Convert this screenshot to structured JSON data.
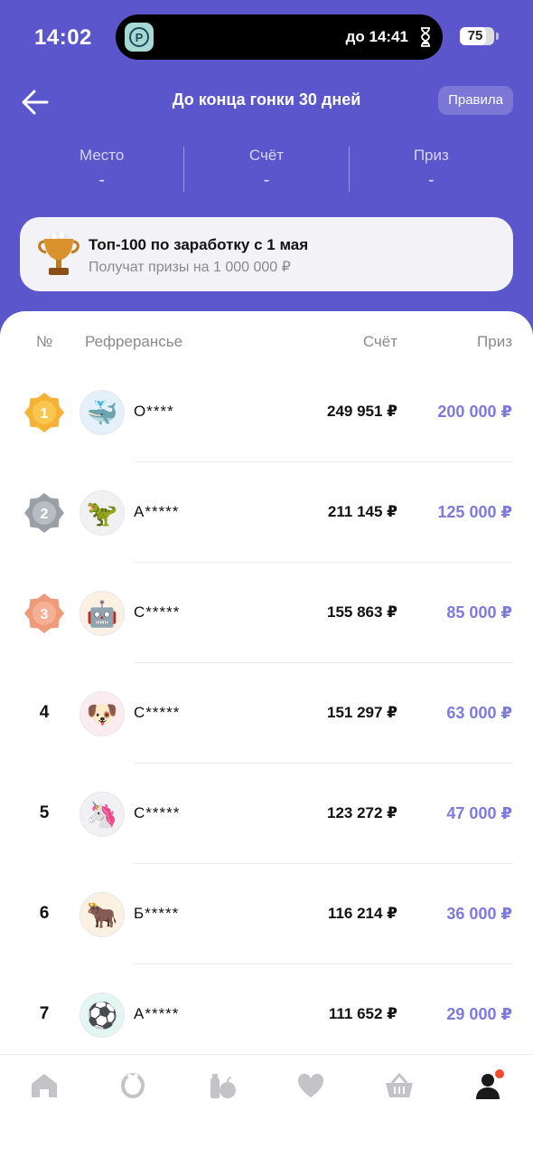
{
  "status_bar": {
    "time": "14:02",
    "activity_icon": "P",
    "activity_text": "до 14:41",
    "battery": "75",
    "battery_level": 0.75
  },
  "header": {
    "title": "До конца гонки 30 дней",
    "rules_label": "Правила"
  },
  "stats": [
    {
      "label": "Место",
      "value": "-"
    },
    {
      "label": "Счёт",
      "value": "-"
    },
    {
      "label": "Приз",
      "value": "-"
    }
  ],
  "banner": {
    "title": "Топ-100 по заработку с 1 мая",
    "subtitle": "Получат призы на 1 000 000 ₽"
  },
  "columns": {
    "rank": "№",
    "name": "Рефрерансье",
    "score": "Счёт",
    "prize": "Приз"
  },
  "rows": [
    {
      "rank": "1",
      "medal": "gold",
      "avatar_icon": "🐳",
      "avatar_bg": "#e4f1fa",
      "name": "О****",
      "score": "249 951 ₽",
      "prize": "200 000 ₽"
    },
    {
      "rank": "2",
      "medal": "silver",
      "avatar_icon": "🦖",
      "avatar_bg": "#f1f1f4",
      "name": "А*****",
      "score": "211 145 ₽",
      "prize": "125 000 ₽"
    },
    {
      "rank": "3",
      "medal": "bronze",
      "avatar_icon": "🤖",
      "avatar_bg": "#fbf1e2",
      "name": "С*****",
      "score": "155 863 ₽",
      "prize": "85 000 ₽"
    },
    {
      "rank": "4",
      "medal": "",
      "avatar_icon": "🐶",
      "avatar_bg": "#fbecef",
      "name": "С*****",
      "score": "151 297 ₽",
      "prize": "63 000 ₽"
    },
    {
      "rank": "5",
      "medal": "",
      "avatar_icon": "🦄",
      "avatar_bg": "#f1f1f4",
      "name": "С*****",
      "score": "123 272 ₽",
      "prize": "47 000 ₽"
    },
    {
      "rank": "6",
      "medal": "",
      "avatar_icon": "🐂",
      "avatar_bg": "#fbf1e2",
      "name": "Б*****",
      "score": "116 214 ₽",
      "prize": "36 000 ₽"
    },
    {
      "rank": "7",
      "medal": "",
      "avatar_icon": "⚽",
      "avatar_bg": "#e4f6f1",
      "name": "А*****",
      "score": "111 652 ₽",
      "prize": "29 000 ₽"
    }
  ],
  "tabs": [
    "home-icon",
    "alice-icon",
    "groceries-icon",
    "favorites-icon",
    "basket-icon",
    "profile-icon"
  ],
  "colors": {
    "accent": "#5b56cc",
    "prize": "#7e79de",
    "notification": "#f44a2c"
  }
}
